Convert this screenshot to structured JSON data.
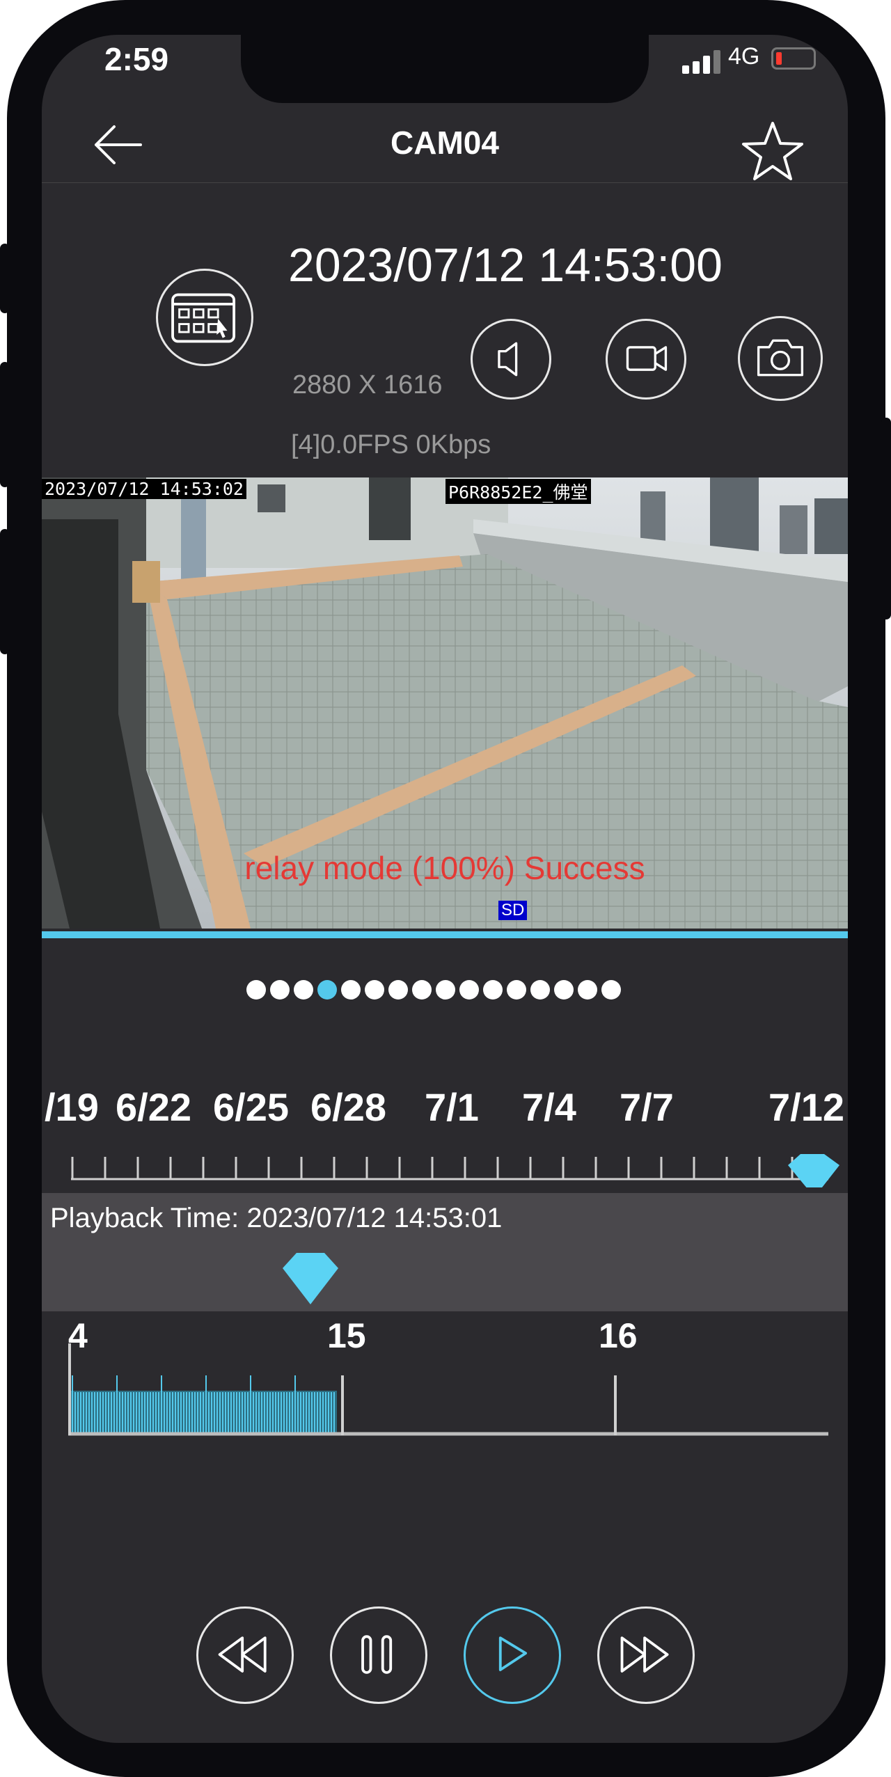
{
  "status_bar": {
    "time": "2:59",
    "network": "4G"
  },
  "header": {
    "title": "CAM04"
  },
  "info": {
    "datetime": "2023/07/12 14:53:00",
    "resolution": "2880 X 1616",
    "stats": "[4]0.0FPS 0Kbps"
  },
  "video": {
    "osd_time": "2023/07/12 14:53:02",
    "osd_camera": "P6R8852E2_佛堂",
    "relay_status": "relay mode (100%) Success",
    "badge": "SD"
  },
  "page_dots": {
    "count": 16,
    "active_index": 3
  },
  "date_timeline": {
    "labels": [
      "/19",
      "6/22",
      "6/25",
      "6/28",
      "7/1",
      "7/4",
      "7/7",
      "7/12"
    ]
  },
  "playback": {
    "label": "Playback Time: 2023/07/12 14:53:01"
  },
  "hour_timeline": {
    "labels": [
      "4",
      "15",
      "16"
    ]
  },
  "colors": {
    "accent": "#54c9ec",
    "background": "#2b2a2e",
    "relay_text": "#e53935",
    "bar": "#4a484c"
  },
  "icons": {
    "back": "arrow-left-icon",
    "favorite": "star-icon",
    "calendar": "calendar-icon",
    "audio": "speaker-icon",
    "record": "video-camera-icon",
    "snapshot": "camera-icon",
    "rewind": "rewind-icon",
    "pause": "pause-icon",
    "play": "play-icon",
    "forward": "fast-forward-icon"
  }
}
